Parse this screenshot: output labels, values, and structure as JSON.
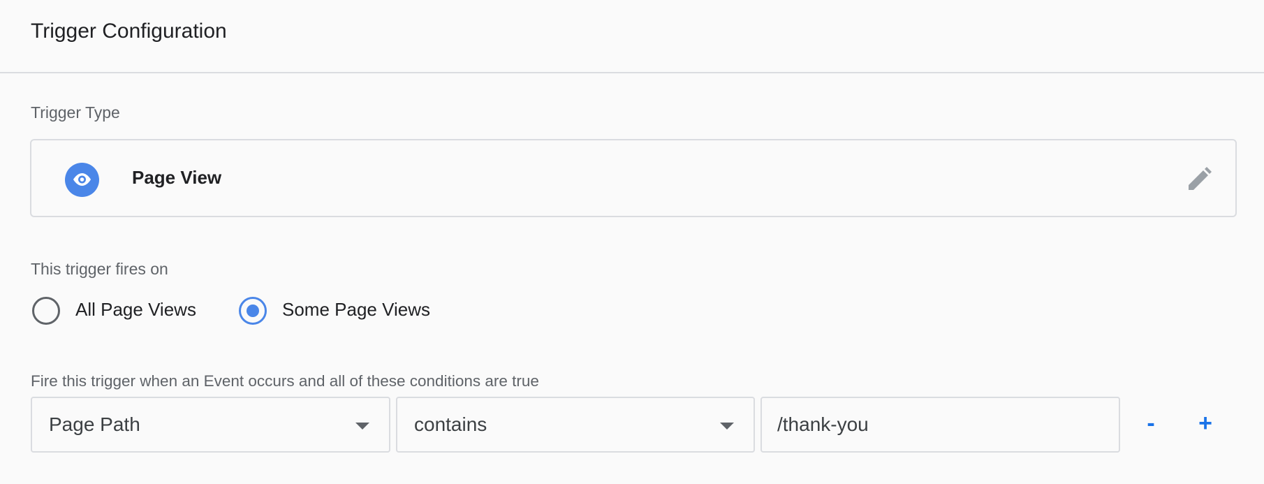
{
  "header": {
    "title": "Trigger Configuration"
  },
  "trigger_type": {
    "label": "Trigger Type",
    "name": "Page View",
    "icon": "eye-icon",
    "icon_color": "#4a86e8",
    "edit_icon": "pencil-icon"
  },
  "fires_on": {
    "label": "This trigger fires on",
    "options": [
      {
        "label": "All Page Views",
        "selected": false
      },
      {
        "label": "Some Page Views",
        "selected": true
      }
    ]
  },
  "conditions": {
    "label": "Fire this trigger when an Event occurs and all of these conditions are true",
    "rows": [
      {
        "variable": "Page Path",
        "operator": "contains",
        "value": "/thank-you"
      }
    ],
    "remove_label": "-",
    "add_label": "+",
    "accent_color": "#1a73e8"
  }
}
